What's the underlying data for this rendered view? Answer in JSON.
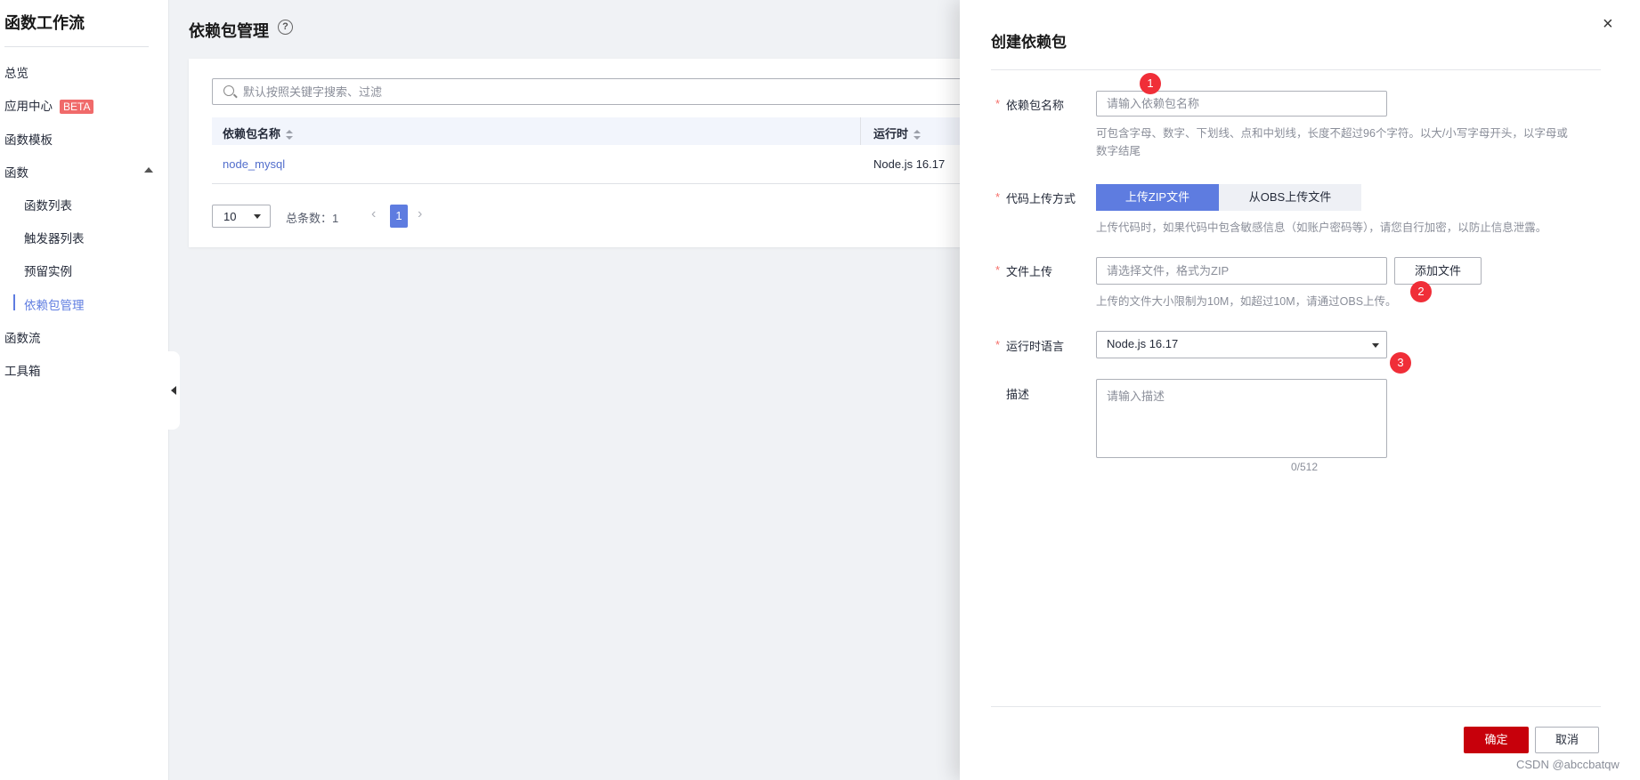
{
  "sidebar": {
    "title": "函数工作流",
    "items": {
      "overview": "总览",
      "app_center": "应用中心",
      "app_center_badge": "BETA",
      "templates": "函数模板",
      "functions": "函数",
      "function_list": "函数列表",
      "trigger_list": "触发器列表",
      "reserved_instances": "预留实例",
      "dependency_mgmt": "依赖包管理",
      "function_flow": "函数流",
      "toolbox": "工具箱"
    }
  },
  "main": {
    "title": "依赖包管理",
    "search_placeholder": "默认按照关键字搜索、过滤",
    "table": {
      "columns": [
        "依赖包名称",
        "运行时"
      ],
      "rows": [
        {
          "name": "node_mysql",
          "runtime": "Node.js 16.17"
        }
      ]
    },
    "pagination": {
      "page_size": "10",
      "total": "总条数：1",
      "current": "1"
    }
  },
  "panel": {
    "title": "创建依赖包",
    "close": "×",
    "name_label": "依赖包名称",
    "name_placeholder": "请输入依赖包名称",
    "name_hint_1": "可包含字母、数字、下划线、点和中划线，长度不超过96个字符。以大/小写字母开头，以字母或",
    "name_hint_2": "数字结尾",
    "upload_method_label": "代码上传方式",
    "upload_zip": "上传ZIP文件",
    "upload_obs": "从OBS上传文件",
    "upload_hint": "上传代码时，如果代码中包含敏感信息（如账户密码等），请您自行加密，以防止信息泄露。",
    "file_label": "文件上传",
    "file_placeholder": "请选择文件，格式为ZIP",
    "add_file": "添加文件",
    "file_hint": "上传的文件大小限制为10M，如超过10M，请通过OBS上传。",
    "runtime_label": "运行时语言",
    "runtime_value": "Node.js 16.17",
    "desc_label": "描述",
    "desc_placeholder": "请输入描述",
    "desc_counter": "0/512",
    "confirm": "确定",
    "cancel": "取消",
    "required_mark": "*"
  },
  "markers": [
    "1",
    "2",
    "3"
  ],
  "watermark": "CSDN @abccbatqw",
  "colors": {
    "primary": "#5e7ce0",
    "danger": "#c7000b",
    "marker": "#f02e38",
    "badge": "#f06a6a"
  }
}
